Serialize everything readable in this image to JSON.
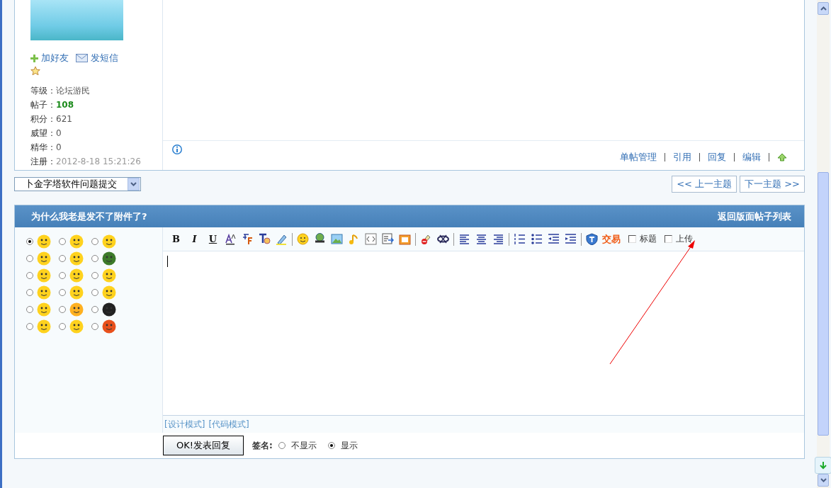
{
  "post": {
    "author_links": [
      "加好友",
      "发短信"
    ],
    "stats": [
      {
        "label": "等级：",
        "value": "论坛游民",
        "kind": "plain"
      },
      {
        "label": "帖子：",
        "value": "108",
        "kind": "highlight"
      },
      {
        "label": "积分：",
        "value": "621",
        "kind": "plain"
      },
      {
        "label": "威望：",
        "value": "0",
        "kind": "plain"
      },
      {
        "label": "精华：",
        "value": "0",
        "kind": "plain"
      },
      {
        "label": "注册：",
        "value": "2012-8-18 15:21:26",
        "kind": "muted"
      }
    ],
    "actions": [
      "单帖管理",
      "引用",
      "回复",
      "编辑"
    ]
  },
  "forum_select": {
    "value": "卜金字塔软件问题提交"
  },
  "nav_buttons": [
    "<< 上一主题",
    "下一主题 >>"
  ],
  "reply": {
    "title": "为什么我老是发不了附件了?",
    "back_link": "返回版面帖子列表",
    "emoticons": [
      {
        "selected": true
      },
      {
        "selected": false
      },
      {
        "selected": false
      },
      {
        "selected": false
      },
      {
        "selected": false
      },
      {
        "selected": false
      },
      {
        "selected": false
      },
      {
        "selected": false
      },
      {
        "selected": false
      },
      {
        "selected": false
      },
      {
        "selected": false
      },
      {
        "selected": false
      },
      {
        "selected": false
      },
      {
        "selected": false
      },
      {
        "selected": false
      },
      {
        "selected": false
      },
      {
        "selected": false
      },
      {
        "selected": false
      }
    ],
    "format_buttons": [
      "B",
      "I",
      "U"
    ],
    "trade_button": "交易",
    "options": [
      {
        "label": "标题",
        "checked": false
      },
      {
        "label": "上传",
        "checked": false
      }
    ],
    "modes": [
      "[设计模式]",
      "[代码模式]"
    ],
    "submit": "OK!发表回复",
    "signature": {
      "label": "签名:",
      "choices": [
        {
          "label": "不显示",
          "selected": false
        },
        {
          "label": "显示",
          "selected": true
        }
      ]
    }
  }
}
